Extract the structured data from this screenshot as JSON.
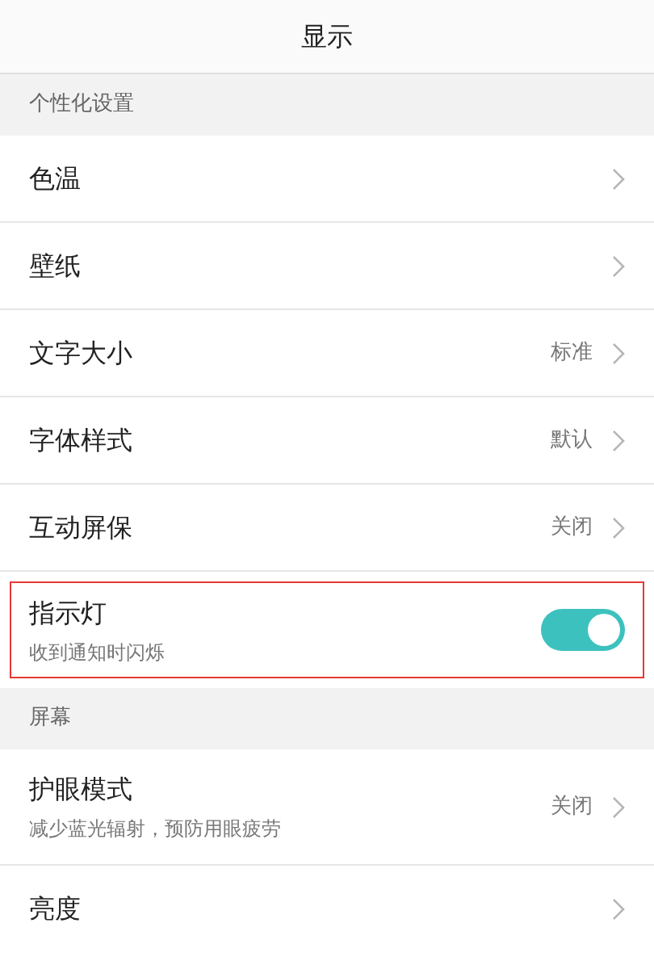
{
  "title": "显示",
  "sections": [
    {
      "header": "个性化设置",
      "items": [
        {
          "kind": "link",
          "label": "色温"
        },
        {
          "kind": "link",
          "label": "壁纸"
        },
        {
          "kind": "link",
          "label": "文字大小",
          "value": "标准"
        },
        {
          "kind": "link",
          "label": "字体样式",
          "value": "默认"
        },
        {
          "kind": "link",
          "label": "互动屏保",
          "value": "关闭"
        },
        {
          "kind": "toggle",
          "label": "指示灯",
          "subtitle": "收到通知时闪烁",
          "on": true,
          "highlighted": true
        }
      ]
    },
    {
      "header": "屏幕",
      "items": [
        {
          "kind": "link",
          "label": "护眼模式",
          "subtitle": "减少蓝光辐射，预防用眼疲劳",
          "value": "关闭"
        },
        {
          "kind": "link",
          "label": "亮度"
        }
      ]
    }
  ]
}
